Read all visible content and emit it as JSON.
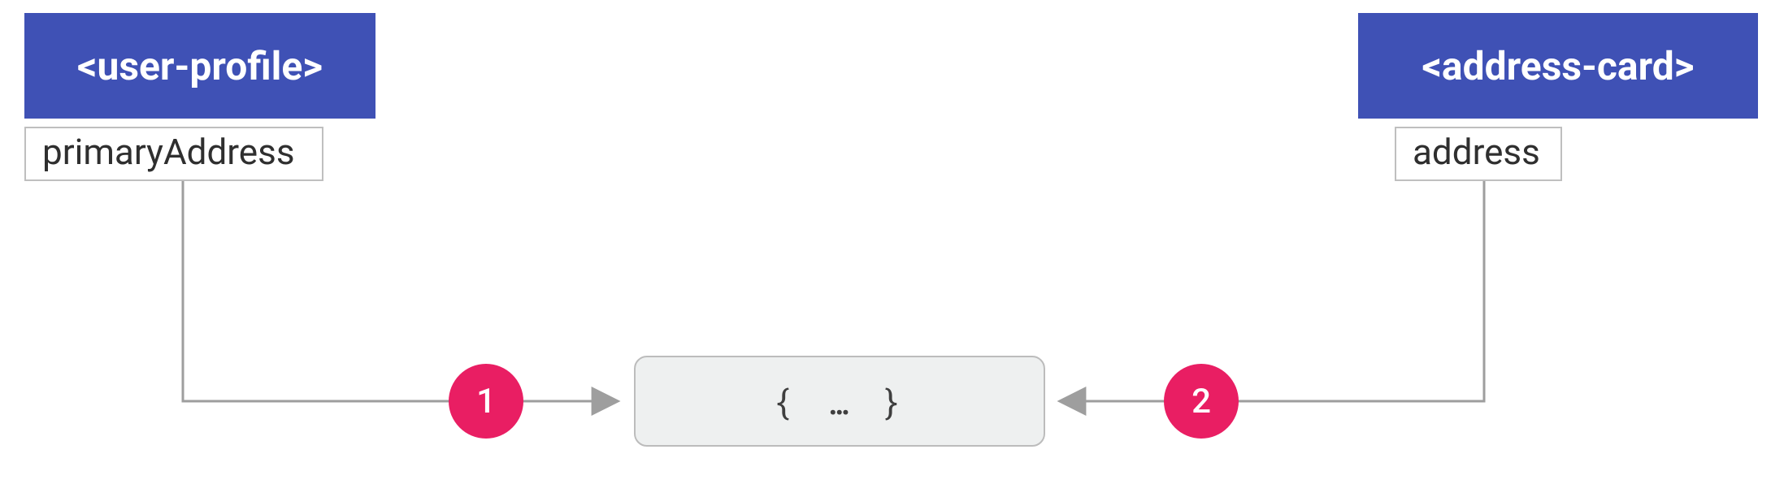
{
  "diagram": {
    "left_component": {
      "label": "<user-profile>",
      "property": "primaryAddress"
    },
    "right_component": {
      "label": "<address-card>",
      "property": "address"
    },
    "center_object": {
      "label": "{  …  }"
    },
    "badge1": "1",
    "badge2": "2",
    "colors": {
      "component_bg": "#3F51B5",
      "badge_bg": "#E91E63",
      "object_bg": "#eef0f0"
    }
  }
}
